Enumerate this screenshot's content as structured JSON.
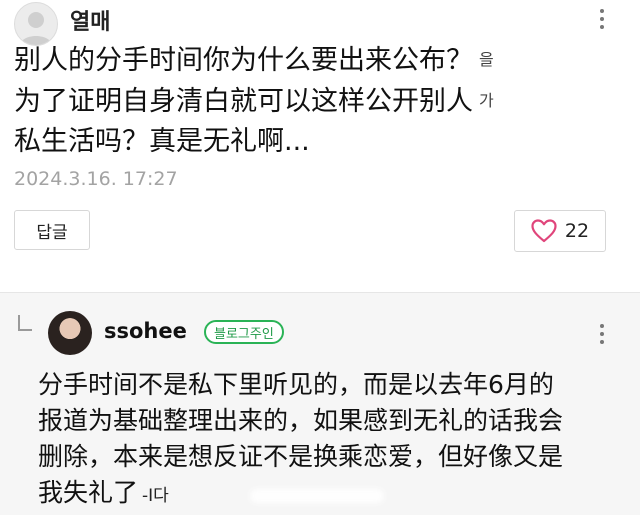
{
  "comment": {
    "author": "열매",
    "lines": [
      {
        "text": "别人的分手时间你为什么要出来公布？",
        "tail": "을"
      },
      {
        "text": "为了证明自身清白就可以这样公开别人",
        "tail": "가"
      },
      {
        "text": "私生活吗？真是无礼啊...",
        "tail": ""
      }
    ],
    "timestamp": "2024.3.16. 17:27",
    "reply_button": "답글",
    "like_count": "22"
  },
  "reply": {
    "author": "ssohee",
    "badge": "블로그주인",
    "lines": [
      {
        "text": "分手时间不是私下里听见的，而是以去年6月的",
        "tail": ""
      },
      {
        "text": "报道为基础整理出来的，如果感到无礼的话我会",
        "tail": ""
      },
      {
        "text": "删除，本来是想反证不是换乘恋爱，但好像又是",
        "tail": ""
      },
      {
        "text": "我失礼了",
        "tail": "-I다"
      }
    ]
  },
  "colors": {
    "badge_green": "#2ab356",
    "heart_pink": "#e0457b",
    "timestamp_gray": "#a3a3a3",
    "reply_bg": "#f6f6f6"
  },
  "icons": {
    "more": "vertical-ellipsis-icon",
    "like": "heart-outline-icon",
    "reply_indicator": "reply-arrow-icon"
  }
}
